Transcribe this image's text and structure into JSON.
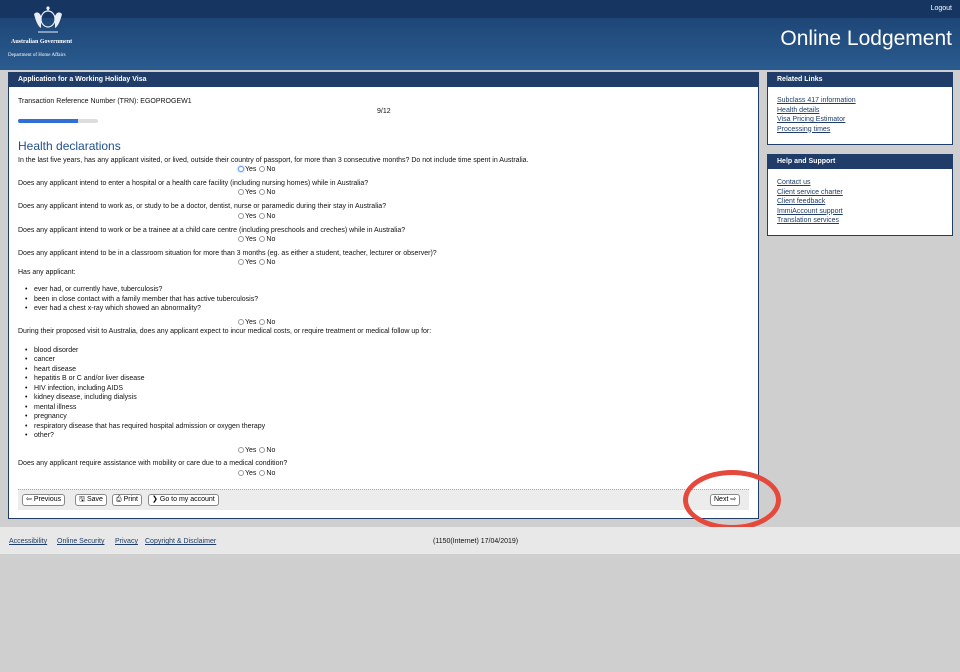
{
  "header": {
    "logout": "Logout",
    "gov_line1": "Australian Government",
    "gov_line2": "Department of Home Affairs",
    "title": "Online Lodgement"
  },
  "main": {
    "panel_title": "Application for a Working Holiday Visa",
    "trn": "Transaction Reference Number (TRN): EGOPROGEW1",
    "page_indicator": "9/12",
    "progress_fraction": 0.75,
    "section_title": "Health declarations",
    "yes": "Yes",
    "no": "No",
    "questions": [
      "In the last five years, has any applicant visited, or lived, outside their country of passport, for more than 3 consecutive months? Do not include time spent in Australia.",
      "Does any applicant intend to enter a hospital or a health care facility (including nursing homes) while in Australia?",
      "Does any applicant intend to work as, or study to be a doctor, dentist, nurse or paramedic during their stay in Australia?",
      "Does any applicant intend to work or be a trainee at a child care centre (including preschools and creches) while in Australia?",
      "Does any applicant intend to be in a classroom situation for more than 3 months (eg. as either a student, teacher, lecturer or observer)?",
      "Has any applicant:",
      "During their proposed visit to Australia, does any applicant expect to incur medical costs, or require treatment or medical follow up for:",
      "Does any applicant require assistance with mobility or care due to a medical condition?"
    ],
    "tb_items": [
      "ever had, or currently have, tuberculosis?",
      "been in close contact with a family member that has active tuberculosis?",
      "ever had a chest x-ray which showed an abnormality?"
    ],
    "medical_items": [
      "blood disorder",
      "cancer",
      "heart disease",
      "hepatitis B or C and/or liver disease",
      "HIV infection, including AIDS",
      "kidney disease, including dialysis",
      "mental illness",
      "pregnancy",
      "respiratory disease that has required hospital admission or oxygen therapy",
      "other?"
    ],
    "buttons": {
      "previous": "Previous",
      "save": "Save",
      "print": "Print",
      "account": "Go to my account",
      "next": "Next"
    }
  },
  "related_links": {
    "title": "Related Links",
    "items": [
      "Subclass 417 information",
      "Health details",
      "Visa Pricing Estimator",
      "Processing times"
    ]
  },
  "help_support": {
    "title": "Help and Support",
    "items": [
      "Contact us",
      "Client service charter",
      "Client feedback",
      "ImmiAccount support",
      "Translation services"
    ]
  },
  "footer": {
    "accessibility": "Accessibility",
    "online_security": "Online Security",
    "privacy": "Privacy",
    "copyright": "Copyright & Disclaimer",
    "build": "(1150(Internet) 17/04/2019)"
  },
  "icons": [
    "crest-icon",
    "arrow-left-icon",
    "save-icon",
    "print-icon",
    "chevron-right-icon",
    "arrow-right-icon"
  ]
}
